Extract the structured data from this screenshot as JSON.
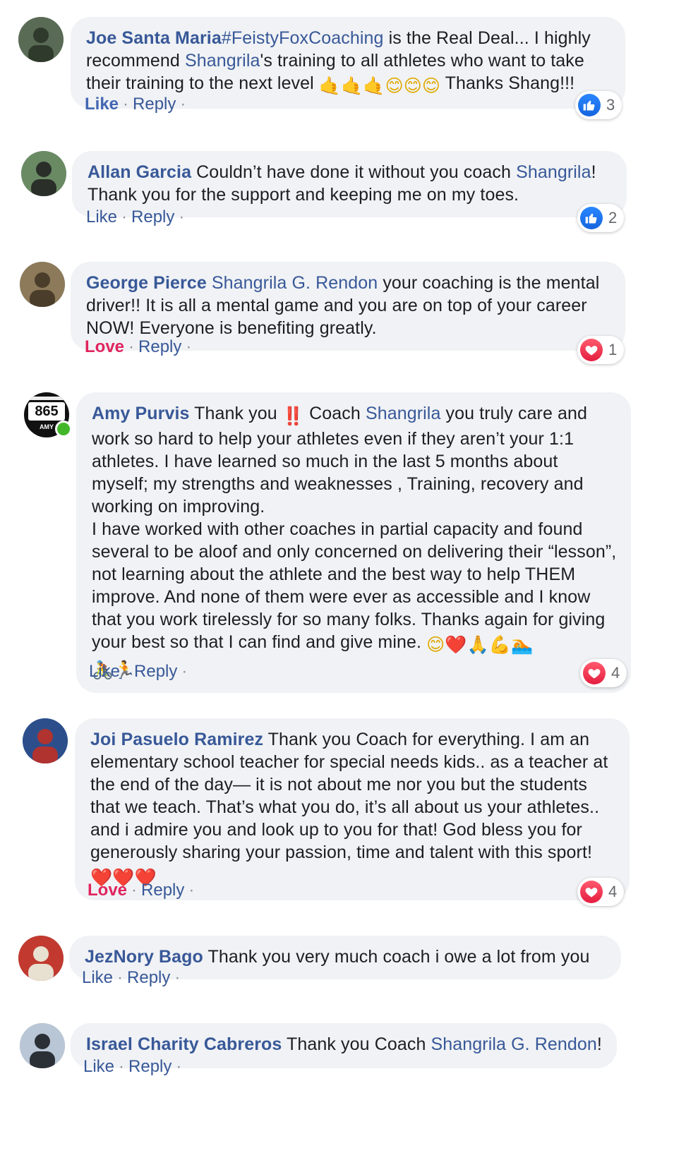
{
  "comments": [
    {
      "author": "Joe Santa Maria",
      "segments": [
        {
          "type": "mention",
          "text": "#FeistyFoxCoaching"
        },
        {
          "type": "text",
          "text": " is the Real Deal... I highly recommend "
        },
        {
          "type": "mention",
          "text": "Shangrila"
        },
        {
          "type": "text",
          "text": "'s training to all athletes who want to take their training to the next level "
        },
        {
          "type": "emoji",
          "text": "🤙🤙🤙",
          "cls": "tan",
          "icon": "call-me-hand-icon"
        },
        {
          "type": "emoji",
          "text": "😊😊😊",
          "cls": "smile",
          "icon": "smiling-face-icon"
        },
        {
          "type": "text",
          "text": " Thanks Shang!!!"
        }
      ],
      "like_label": "Like",
      "like_state": "like",
      "reply_label": "Reply",
      "reaction": {
        "type": "like",
        "count": "3",
        "icon": "thumbs-up-icon"
      },
      "avatar_colors": [
        "#5a6b55",
        "#2f3a2c"
      ]
    },
    {
      "author": "Allan Garcia",
      "segments": [
        {
          "type": "text",
          "text": " Couldn’t have done it without you coach "
        },
        {
          "type": "mention",
          "text": "Shangrila"
        },
        {
          "type": "text",
          "text": "! Thank you for the support and keeping me on my toes."
        }
      ],
      "like_label": "Like",
      "like_state": "none",
      "reply_label": "Reply",
      "reaction": {
        "type": "like",
        "count": "2",
        "icon": "thumbs-up-icon"
      },
      "avatar_colors": [
        "#6a8a63",
        "#2a2f2a"
      ]
    },
    {
      "author": "George Pierce",
      "segments": [
        {
          "type": "text",
          "text": " "
        },
        {
          "type": "mention",
          "text": "Shangrila G. Rendon"
        },
        {
          "type": "text",
          "text": " your coaching is the mental driver!! It is all a mental game and you are on top of your career NOW! Everyone is benefiting greatly."
        }
      ],
      "like_label": "Love",
      "like_state": "love",
      "reply_label": "Reply",
      "reaction": {
        "type": "love",
        "count": "1",
        "icon": "heart-icon"
      },
      "avatar_colors": [
        "#8c7a5a",
        "#4a3d2a"
      ]
    },
    {
      "author": "Amy Purvis",
      "segments": [
        {
          "type": "text",
          "text": " Thank you "
        },
        {
          "type": "emoji",
          "text": "‼️",
          "cls": "bang",
          "icon": "double-exclamation-icon"
        },
        {
          "type": "text",
          "text": " Coach "
        },
        {
          "type": "mention",
          "text": "Shangrila"
        },
        {
          "type": "text",
          "text": " you truly care and work so hard to help your athletes even if they aren’t your 1:1 athletes. I have learned so much in the last 5 months about myself; my strengths and weaknesses , Training, recovery and working on improving."
        },
        {
          "type": "break"
        },
        {
          "type": "text",
          "text": "I have worked with other coaches in partial capacity and found several to be aloof and only concerned on delivering their “lesson”, not learning about the athlete and the best way to help THEM improve. And none of them were ever as accessible and I know that you work tirelessly for so many folks. Thanks again for giving your best so that I can find and give mine. "
        },
        {
          "type": "emoji",
          "text": "😊",
          "cls": "smile",
          "icon": "smiling-face-icon"
        },
        {
          "type": "emoji",
          "text": "❤️",
          "cls": "red",
          "icon": "red-heart-icon"
        },
        {
          "type": "emoji",
          "text": "🙏💪🏊",
          "cls": "tan",
          "icon": "folded-hands-icon"
        },
        {
          "type": "break"
        },
        {
          "type": "emoji",
          "text": "🚴🏃",
          "cls": "misc",
          "icon": "cyclist-runner-icon"
        }
      ],
      "like_label": "Like",
      "like_state": "none",
      "reply_label": "Reply",
      "reaction": {
        "type": "love",
        "count": "4",
        "icon": "heart-icon"
      },
      "avatar_badge": {
        "top": "865",
        "bottom": "AMY"
      },
      "online": true
    },
    {
      "author": "Joi Pasuelo Ramirez",
      "segments": [
        {
          "type": "text",
          "text": " Thank you Coach for everything. I am an elementary school teacher for special needs kids.. as a teacher at the end of the day— it is not about me nor you but the students that we teach. That’s what you do, it’s all about us your athletes.. and i admire you and look up to you for that! God bless you for generously sharing your passion, time and talent with this sport! "
        },
        {
          "type": "emoji",
          "text": "❤️❤️❤️",
          "cls": "red",
          "icon": "red-heart-icon"
        }
      ],
      "like_label": "Love",
      "like_state": "love",
      "reply_label": "Reply",
      "reaction": {
        "type": "love",
        "count": "4",
        "icon": "heart-icon"
      },
      "avatar_colors": [
        "#2c4f8c",
        "#b0332f"
      ]
    },
    {
      "author": "JezNory Bago",
      "segments": [
        {
          "type": "text",
          "text": " Thank you very much coach  i owe a lot from you"
        }
      ],
      "like_label": "Like",
      "like_state": "none",
      "reply_label": "Reply",
      "reaction": null,
      "avatar_colors": [
        "#c23a2f",
        "#e8e0d0"
      ]
    },
    {
      "author": "Israel Charity Cabreros",
      "segments": [
        {
          "type": "text",
          "text": " Thank you Coach "
        },
        {
          "type": "mention",
          "text": "Shangrila G. Rendon"
        },
        {
          "type": "text",
          "text": "!"
        }
      ],
      "like_label": "Like",
      "like_state": "none",
      "reply_label": "Reply",
      "reaction": null,
      "avatar_colors": [
        "#b9c6d6",
        "#2b2f36"
      ]
    }
  ]
}
